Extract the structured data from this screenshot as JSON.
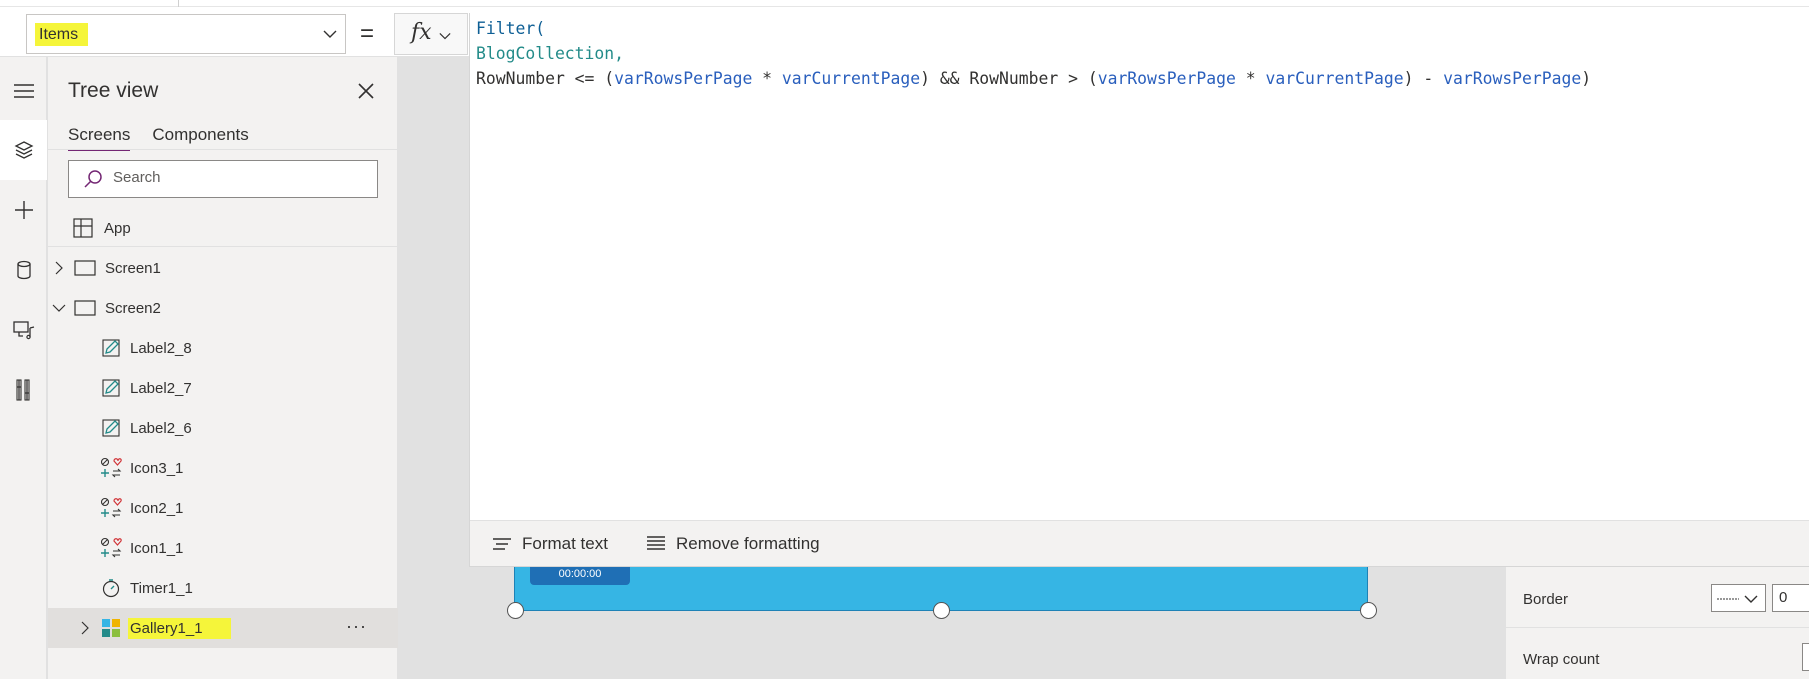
{
  "formula_bar": {
    "property": "Items",
    "equals": "=",
    "fx_label": "fx",
    "formula": {
      "line1_fn": "Filter(",
      "line2_id": "BlogCollection,",
      "l3_a": "RowNumber <= (",
      "l3_var1": "varRowsPerPage",
      "l3_b": " * ",
      "l3_var2": "varCurrentPage",
      "l3_c": ") && RowNumber > (",
      "l3_var3": "varRowsPerPage",
      "l3_d": " * ",
      "l3_var4": "varCurrentPage",
      "l3_e": ") - ",
      "l3_var5": "varRowsPerPage",
      "l3_f": ")"
    },
    "format_text": "Format text",
    "remove_formatting": "Remove formatting"
  },
  "tree_view": {
    "title": "Tree view",
    "tabs": [
      "Screens",
      "Components"
    ],
    "search_placeholder": "Search",
    "app_label": "App",
    "items": [
      {
        "label": "Screen1",
        "type": "screen",
        "expanded": false
      },
      {
        "label": "Screen2",
        "type": "screen",
        "expanded": true
      },
      {
        "label": "Label2_8",
        "type": "label"
      },
      {
        "label": "Label2_7",
        "type": "label"
      },
      {
        "label": "Label2_6",
        "type": "label"
      },
      {
        "label": "Icon3_1",
        "type": "icon"
      },
      {
        "label": "Icon2_1",
        "type": "icon"
      },
      {
        "label": "Icon1_1",
        "type": "icon"
      },
      {
        "label": "Timer1_1",
        "type": "timer"
      },
      {
        "label": "Gallery1_1",
        "type": "gallery",
        "selected": true
      }
    ],
    "more_label": "···"
  },
  "canvas": {
    "timer_text": "00:00:00"
  },
  "properties": {
    "border_label": "Border",
    "border_value": "0",
    "wrap_count_label": "Wrap count"
  },
  "colors": {
    "highlight": "#f5f53a",
    "accent": "#742774",
    "gallery": "#36b5e4"
  }
}
